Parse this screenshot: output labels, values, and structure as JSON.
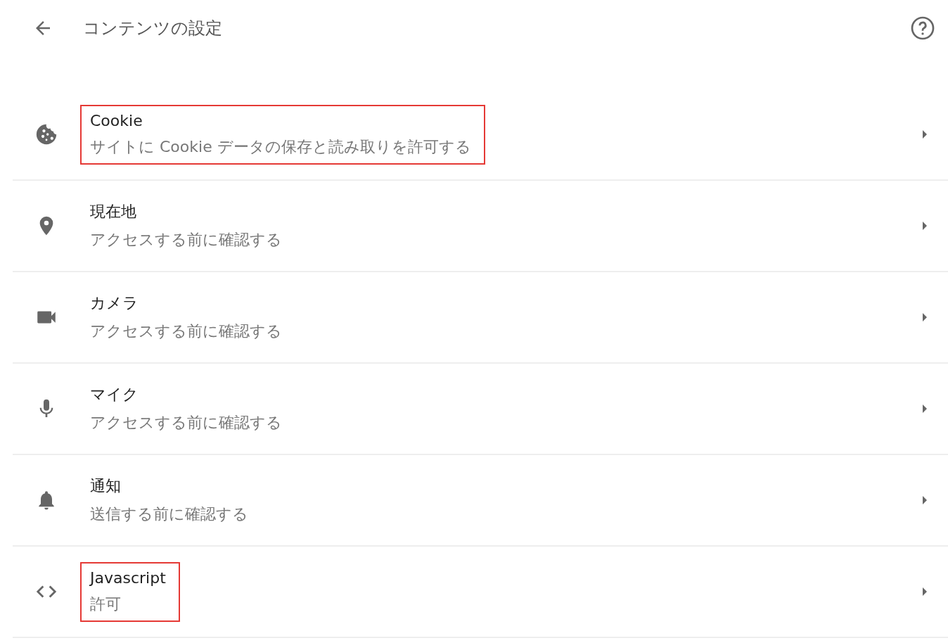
{
  "header": {
    "title": "コンテンツの設定"
  },
  "items": [
    {
      "kind": "cookie",
      "title": "Cookie",
      "subtitle": "サイトに Cookie データの保存と読み取りを許可する",
      "highlighted": true
    },
    {
      "kind": "location",
      "title": "現在地",
      "subtitle": "アクセスする前に確認する",
      "highlighted": false
    },
    {
      "kind": "camera",
      "title": "カメラ",
      "subtitle": "アクセスする前に確認する",
      "highlighted": false
    },
    {
      "kind": "microphone",
      "title": "マイク",
      "subtitle": "アクセスする前に確認する",
      "highlighted": false
    },
    {
      "kind": "notification",
      "title": "通知",
      "subtitle": "送信する前に確認する",
      "highlighted": false
    },
    {
      "kind": "javascript",
      "title": "Javascript",
      "subtitle": "許可",
      "highlighted": true
    }
  ]
}
